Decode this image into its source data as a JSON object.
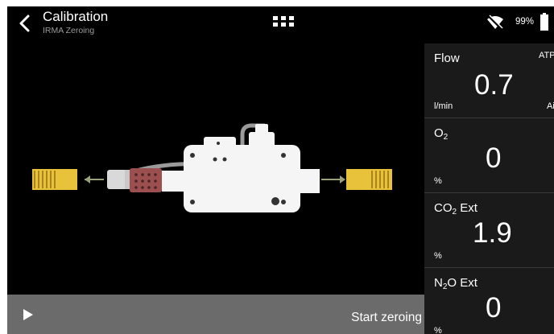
{
  "header": {
    "title": "Calibration",
    "subtitle": "IRMA Zeroing",
    "icons": {
      "back": "chevron-left-icon",
      "menu": "grid-menu-icon",
      "wifi": "wifi-off-icon",
      "battery": "battery-icon"
    },
    "battery_percent": "99%"
  },
  "bottom_bar": {
    "start_label": "Start zeroing",
    "play_icon": "play-icon"
  },
  "parameters": [
    {
      "name": "Flow",
      "value": "0.7",
      "unit": "l/min",
      "extra_top": "ATP",
      "extra_bottom": "Ai"
    },
    {
      "name_main": "O",
      "name_sub": "2",
      "name_rest": "",
      "value": "0",
      "unit": "%"
    },
    {
      "name_main": "CO",
      "name_sub": "2",
      "name_rest": " Ext",
      "value": "1.9",
      "unit": "%"
    },
    {
      "name_main": "N",
      "name_sub": "2",
      "name_rest": "O Ext",
      "value": "0",
      "unit": "%"
    }
  ],
  "colors": {
    "background": "#000000",
    "bottom_bar": "#6b6b6b",
    "panel": "#1a1a1a",
    "connector": "#e8c23a",
    "arrow": "#9aa07a",
    "adapter": "#9b4f4f"
  }
}
